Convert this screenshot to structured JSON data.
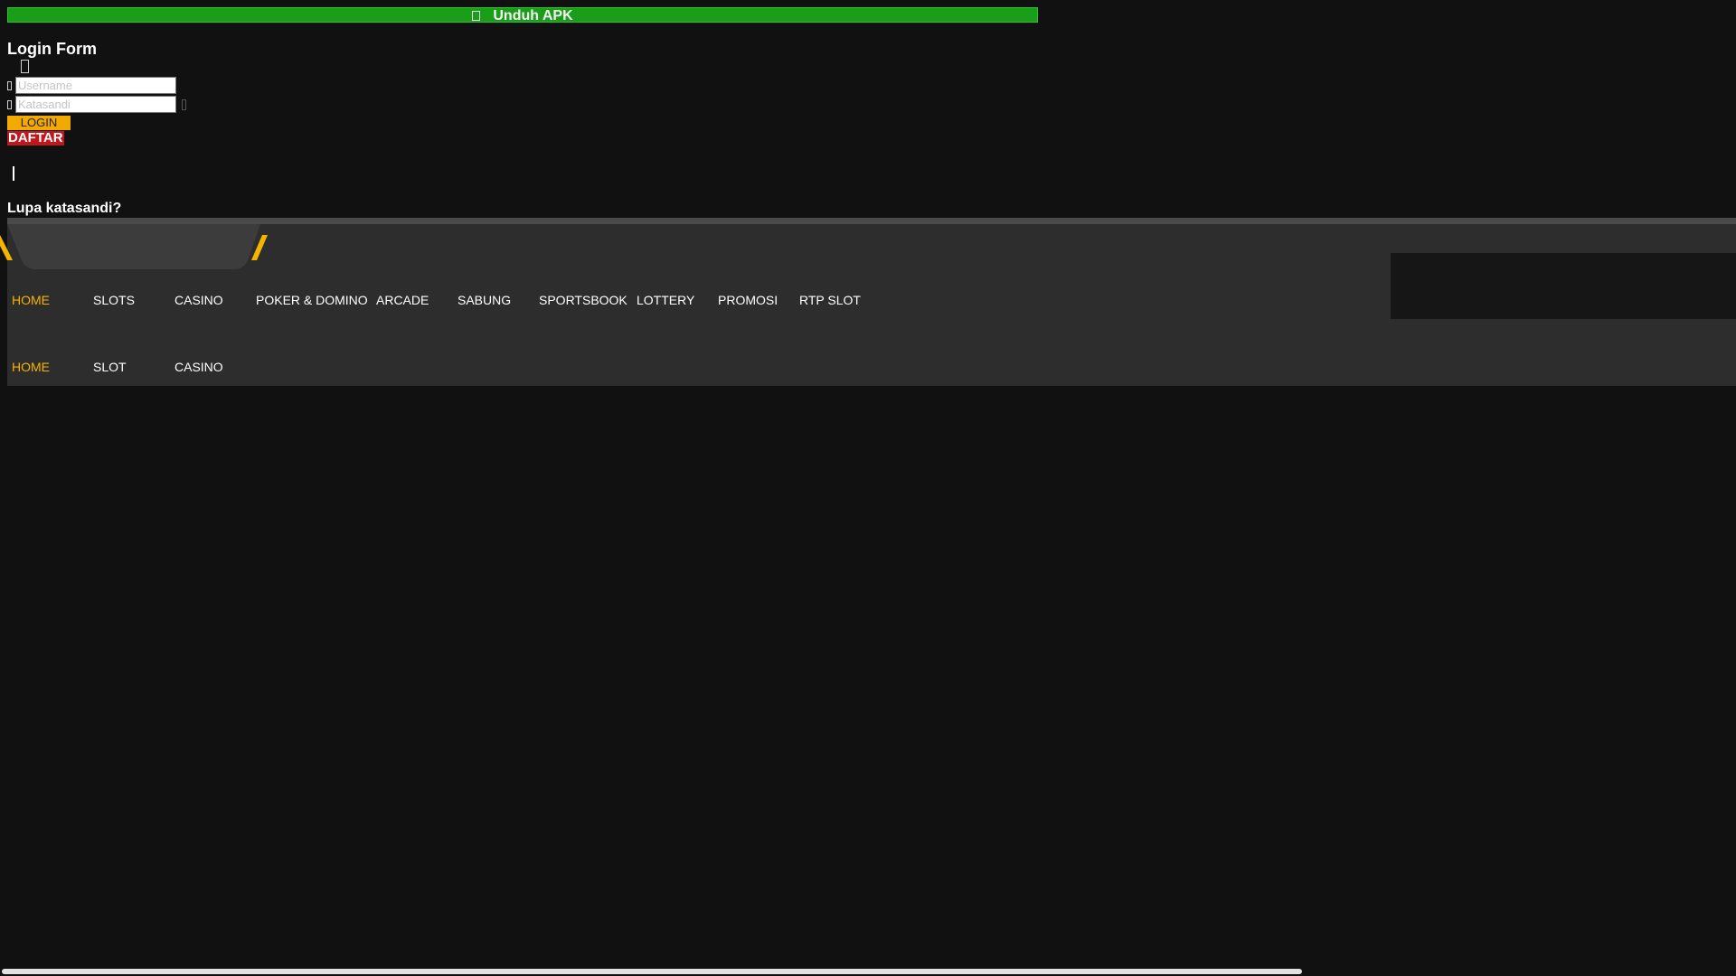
{
  "download_bar": {
    "icon": "android-icon",
    "label": "Unduh APK",
    "color": "#1a9e1a"
  },
  "login_form": {
    "title": "Login Form",
    "close_icon": "close-icon",
    "username": {
      "icon": "user-icon",
      "placeholder": "Username",
      "value": ""
    },
    "password": {
      "icon": "lock-icon",
      "placeholder": "Katasandi",
      "value": "",
      "toggle_icon": "eye-icon"
    },
    "login_label": "LOGIN",
    "register_label": "DAFTAR",
    "separator": "|",
    "forgot_label": "Lupa katasandi?"
  },
  "colors": {
    "accent": "#f5b400",
    "login_button": "#f2a900",
    "register_button": "#c0161c",
    "header_bg": "#2d2d2d",
    "page_bg": "#111111"
  },
  "nav": {
    "primary": [
      {
        "label": "HOME",
        "active": true
      },
      {
        "label": "SLOTS",
        "active": false
      },
      {
        "label": "CASINO",
        "active": false
      },
      {
        "label": "POKER & DOMINO",
        "active": false
      },
      {
        "label": "ARCADE",
        "active": false
      },
      {
        "label": "SABUNG",
        "active": false
      },
      {
        "label": "SPORTSBOOK",
        "active": false
      },
      {
        "label": "LOTTERY",
        "active": false
      },
      {
        "label": "PROMOSI",
        "active": false
      },
      {
        "label": "RTP SLOT",
        "active": false
      }
    ],
    "secondary": [
      {
        "label": "HOME",
        "active": true
      },
      {
        "label": "SLOT",
        "active": false
      },
      {
        "label": "CASINO",
        "active": false
      }
    ]
  }
}
